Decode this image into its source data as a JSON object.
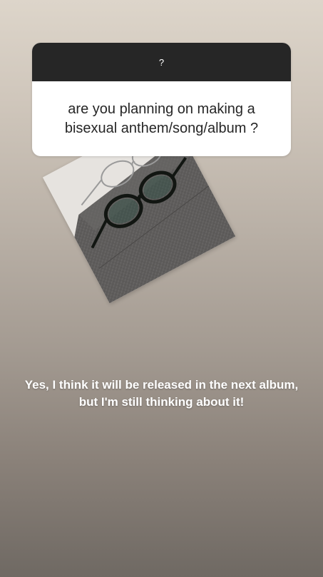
{
  "question_card": {
    "header_label": "?",
    "question": "are you planning on making a\nbisexual anthem/song/album ?"
  },
  "photo": {
    "subject": "glasses-on-gray-fabric"
  },
  "answer": {
    "text": "Yes, I think it will be released in the next album,\nbut I'm still thinking about it!"
  },
  "colors": {
    "card_header": "#262626",
    "card_body": "#ffffff",
    "answer_text": "#ffffff"
  }
}
